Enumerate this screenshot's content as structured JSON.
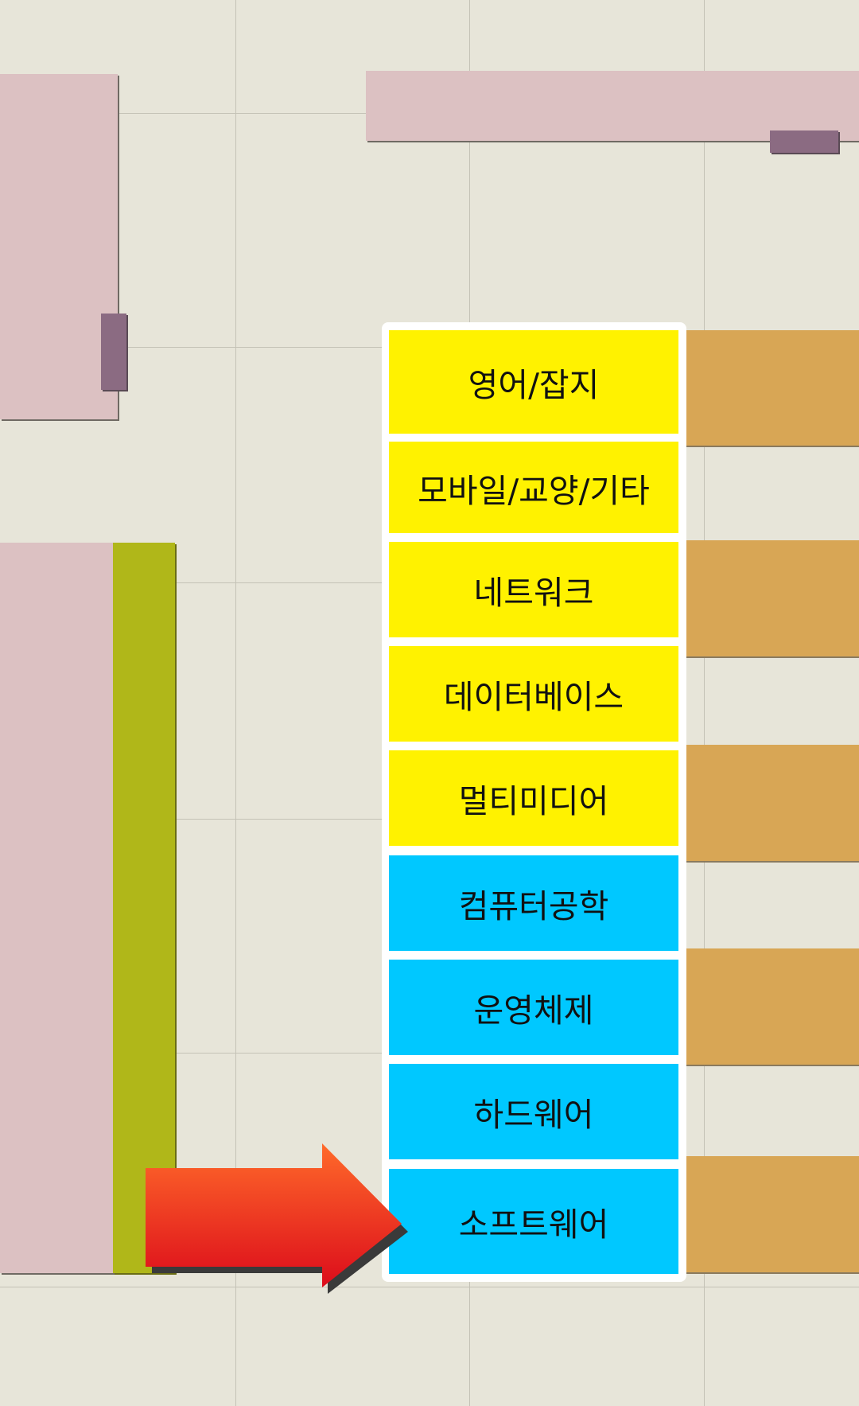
{
  "shelves": [
    {
      "label": "영어/잡지",
      "color": "#fff200"
    },
    {
      "label": "모바일/교양/기타",
      "color": "#fff200"
    },
    {
      "label": "네트워크",
      "color": "#fff200"
    },
    {
      "label": "데이터베이스",
      "color": "#fff200"
    },
    {
      "label": "멀티미디어",
      "color": "#fff200"
    },
    {
      "label": "컴퓨터공학",
      "color": "#00c8ff"
    },
    {
      "label": "운영체제",
      "color": "#00c8ff"
    },
    {
      "label": "하드웨어",
      "color": "#00c8ff"
    },
    {
      "label": "소프트웨어",
      "color": "#00c8ff"
    }
  ],
  "highlighted_shelf": "소프트웨어",
  "colors": {
    "floor": "#e7e5d9",
    "pink_shelf": "#dcc1c2",
    "mauve_marker": "#8b6b82",
    "olive_shelf": "#b0b719",
    "tan_shelf": "#d8a655",
    "arrow": "#e8231c"
  }
}
